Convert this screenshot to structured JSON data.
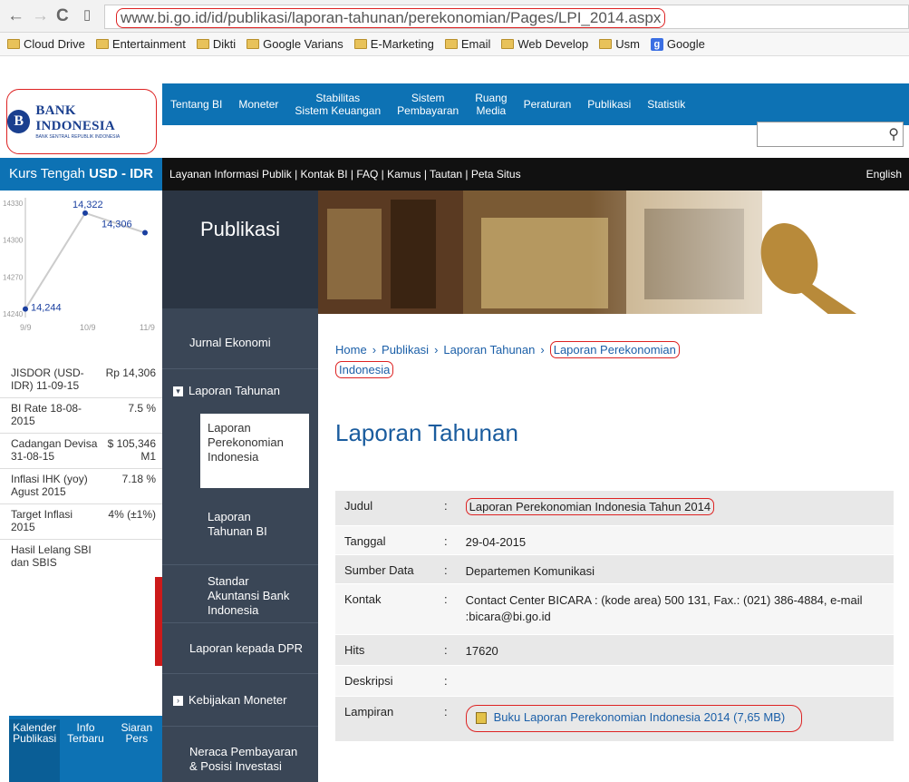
{
  "browser": {
    "back_icon": "back-arrow-icon",
    "forward_icon": "forward-arrow-icon",
    "reload_icon": "reload-icon",
    "url": "www.bi.go.id/id/publikasi/laporan-tahunan/perekonomian/Pages/LPI_2014.aspx"
  },
  "bookmarks": [
    "Cloud Drive",
    "Entertainment",
    "Dikti",
    "Google Varians",
    "E-Marketing",
    "Email",
    "Web Develop",
    "Usm",
    "Google"
  ],
  "logo": {
    "name": "BANK INDONESIA",
    "sub": "BANK SENTRAL REPUBLIK INDONESIA"
  },
  "topnav": [
    "Tentang BI",
    "Moneter",
    "Stabilitas\nSistem Keuangan",
    "Sistem\nPembayaran",
    "Ruang\nMedia",
    "Peraturan",
    "Publikasi",
    "Statistik"
  ],
  "subnav": {
    "links": "Layanan Informasi Publik | Kontak BI | FAQ | Kamus | Tautan | Peta Situs",
    "lang": "English"
  },
  "kurs": {
    "label": "Kurs Tengah ",
    "pair": "USD - IDR"
  },
  "chart_data": {
    "type": "line",
    "x": [
      "9/9",
      "10/9",
      "11/9"
    ],
    "values": [
      14244,
      14322,
      14306
    ],
    "point_labels": [
      "14,244",
      "14,322",
      "14,306"
    ],
    "yticks": [
      "14330",
      "14300",
      "14270",
      "14240"
    ],
    "ylim": [
      14240,
      14330
    ]
  },
  "rates": [
    {
      "label": "JISDOR (USD-IDR) 11-09-15",
      "value": "Rp 14,306"
    },
    {
      "label": "BI Rate 18-08-2015",
      "value": "7.5 %"
    },
    {
      "label": "Cadangan Devisa 31-08-15",
      "value": "$ 105,346 M1"
    },
    {
      "label": "Inflasi IHK (yoy) Agust 2015",
      "value": "7.18 %"
    },
    {
      "label": "Target Inflasi 2015",
      "value": "4% (±1%)"
    },
    {
      "label": "Hasil Lelang SBI dan SBIS",
      "value": ""
    }
  ],
  "cal_tabs": [
    "Kalender\nPublikasi",
    "Info\nTerbaru",
    "Siaran\nPers"
  ],
  "leftmenu": {
    "heading": "Publikasi",
    "items": [
      "Jurnal Ekonomi",
      "Laporan Tahunan",
      "Laporan Perekonomian Indonesia",
      "Laporan Tahunan BI",
      "Standar Akuntansi Bank Indonesia",
      "Laporan kepada DPR",
      "Kebijakan Moneter",
      "Neraca Pembayaran & Posisi Investasi"
    ]
  },
  "breadcrumb": {
    "home": "Home",
    "publikasi": "Publikasi",
    "laporan": "Laporan Tahunan",
    "current": "Laporan Perekonomian",
    "current2": "Indonesia"
  },
  "page_title": "Laporan Tahunan",
  "table": [
    {
      "key": "Judul",
      "value": "Laporan Perekonomian Indonesia Tahun 2014"
    },
    {
      "key": "Tanggal",
      "value": "29-04-2015"
    },
    {
      "key": "Sumber Data",
      "value": "Departemen Komunikasi"
    },
    {
      "key": "Kontak",
      "value": "Contact Center BICARA : (kode area) 500 131, Fax.: (021) 386-4884, e-mail :bicara@bi.go.id"
    },
    {
      "key": "Hits",
      "value": "17620"
    },
    {
      "key": "Deskripsi",
      "value": ""
    },
    {
      "key": "Lampiran",
      "value": "Buku Laporan Perekonomian Indonesia 2014 (7,65 MB)"
    }
  ],
  "colors": {
    "blue": "#0d72b4",
    "dark": "#3a4656",
    "red": "#d22222"
  }
}
